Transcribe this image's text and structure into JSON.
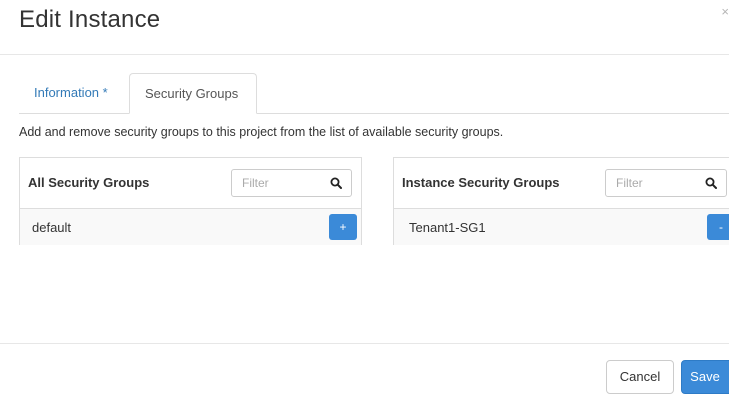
{
  "modal": {
    "title": "Edit Instance",
    "close_label": "×"
  },
  "tabs": [
    {
      "label": "Information *",
      "active": false
    },
    {
      "label": "Security Groups",
      "active": true
    }
  ],
  "help_text": "Add and remove security groups to this project from the list of available security groups.",
  "available_panel": {
    "title": "All Security Groups",
    "filter_placeholder": "Filter",
    "rows": [
      {
        "name": "default",
        "action_label": "+"
      }
    ]
  },
  "assigned_panel": {
    "title": "Instance Security Groups",
    "filter_placeholder": "Filter",
    "rows": [
      {
        "name": "Tenant1-SG1",
        "action_label": "-"
      }
    ]
  },
  "footer": {
    "cancel_label": "Cancel",
    "save_label": "Save"
  },
  "colors": {
    "accent": "#3b8ad8",
    "link": "#337ab7"
  },
  "icons": {
    "search": "search-icon",
    "close": "close-icon"
  }
}
